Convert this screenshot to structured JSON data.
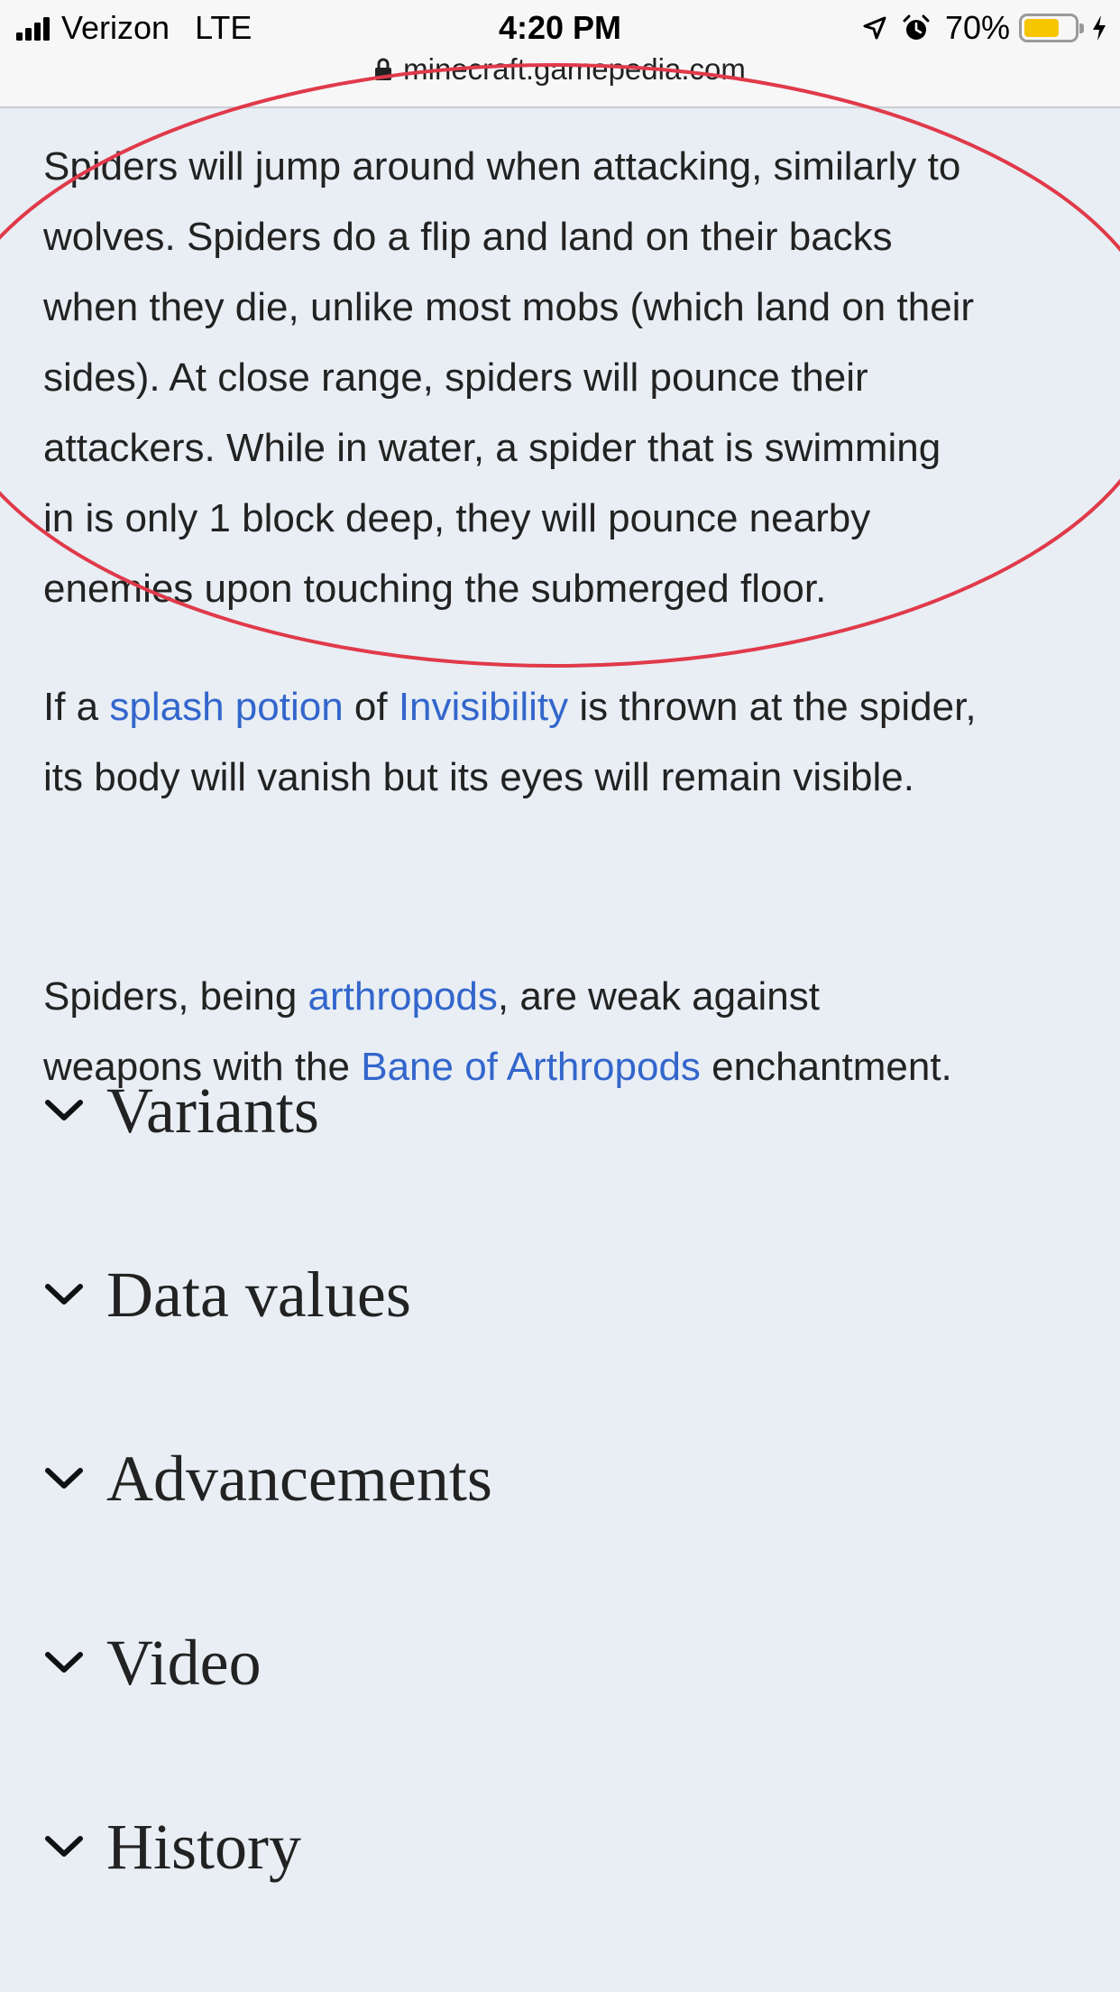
{
  "status_bar": {
    "carrier": "Verizon",
    "network": "LTE",
    "time": "4:20 PM",
    "battery_percent": "70%",
    "battery_level": 0.7,
    "icons": [
      "signal-icon",
      "location-icon",
      "alarm-icon",
      "battery-icon",
      "charging-icon"
    ]
  },
  "url_bar": {
    "domain": "minecraft.gamepedia.com",
    "icon": "lock-icon"
  },
  "article": {
    "paragraph1": {
      "lines": [
        "Spiders will jump around when attacking, similarly to",
        "wolves. Spiders do a flip and land on their backs",
        "when they die, unlike most mobs (which land on their",
        "sides). At close range, spiders will pounce their",
        "attackers. While in water, a spider that is swimming",
        "in is only 1 block deep, they will pounce nearby",
        "enemies upon touching the submerged floor."
      ]
    },
    "paragraph2": {
      "line1_a": "If a ",
      "link_splash": "splash potion",
      "line1_b": " of ",
      "link_invisibility": "Invisibility",
      "line1_c": " is thrown at the spider,",
      "line2": "its body will vanish but its eyes will remain visible."
    },
    "paragraph3": {
      "line1_a": "Spiders, being ",
      "link_arthropods": "arthropods",
      "line1_b": ", are weak against",
      "line2_a": "weapons with the ",
      "link_bane": "Bane of Arthropods",
      "line2_b": " enchantment."
    }
  },
  "sections": [
    {
      "title": "Variants",
      "icon": "chevron-down-icon"
    },
    {
      "title": "Data values",
      "icon": "chevron-down-icon"
    },
    {
      "title": "Advancements",
      "icon": "chevron-down-icon"
    },
    {
      "title": "Video",
      "icon": "chevron-down-icon"
    },
    {
      "title": "History",
      "icon": "chevron-down-icon"
    }
  ],
  "colors": {
    "page_background": "#e8eef4",
    "text": "#222222",
    "link": "#3366cc",
    "annotation": "#e03a4a",
    "battery_fill": "#f7c600"
  }
}
